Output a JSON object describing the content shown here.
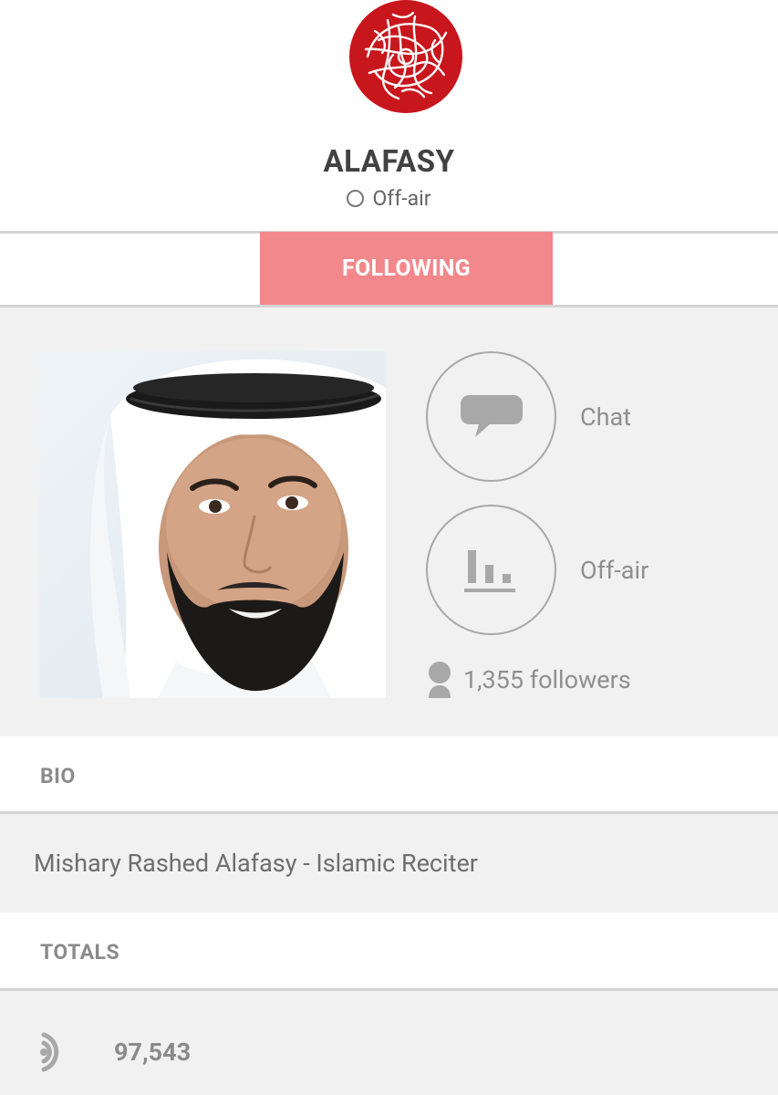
{
  "channel": {
    "title": "ALAFASY",
    "status": "Off-air"
  },
  "follow_button": {
    "label": "FOLLOWING"
  },
  "actions": {
    "chat_label": "Chat",
    "broadcast_label": "Off-air"
  },
  "followers_text": "1,355 followers",
  "bio": {
    "heading": "BIO",
    "text": "Mishary Rashed Alafasy - Islamic Reciter"
  },
  "totals": {
    "heading": "TOTALS",
    "listens": "97,543"
  },
  "colors": {
    "accent": "#f2888c",
    "logo_red": "#c8161d",
    "background": "#f1f1f1"
  },
  "icons": [
    "calligraphy-logo",
    "status-circle-icon",
    "chat-bubble-icon",
    "bar-chart-icon",
    "person-icon",
    "listens-icon"
  ]
}
